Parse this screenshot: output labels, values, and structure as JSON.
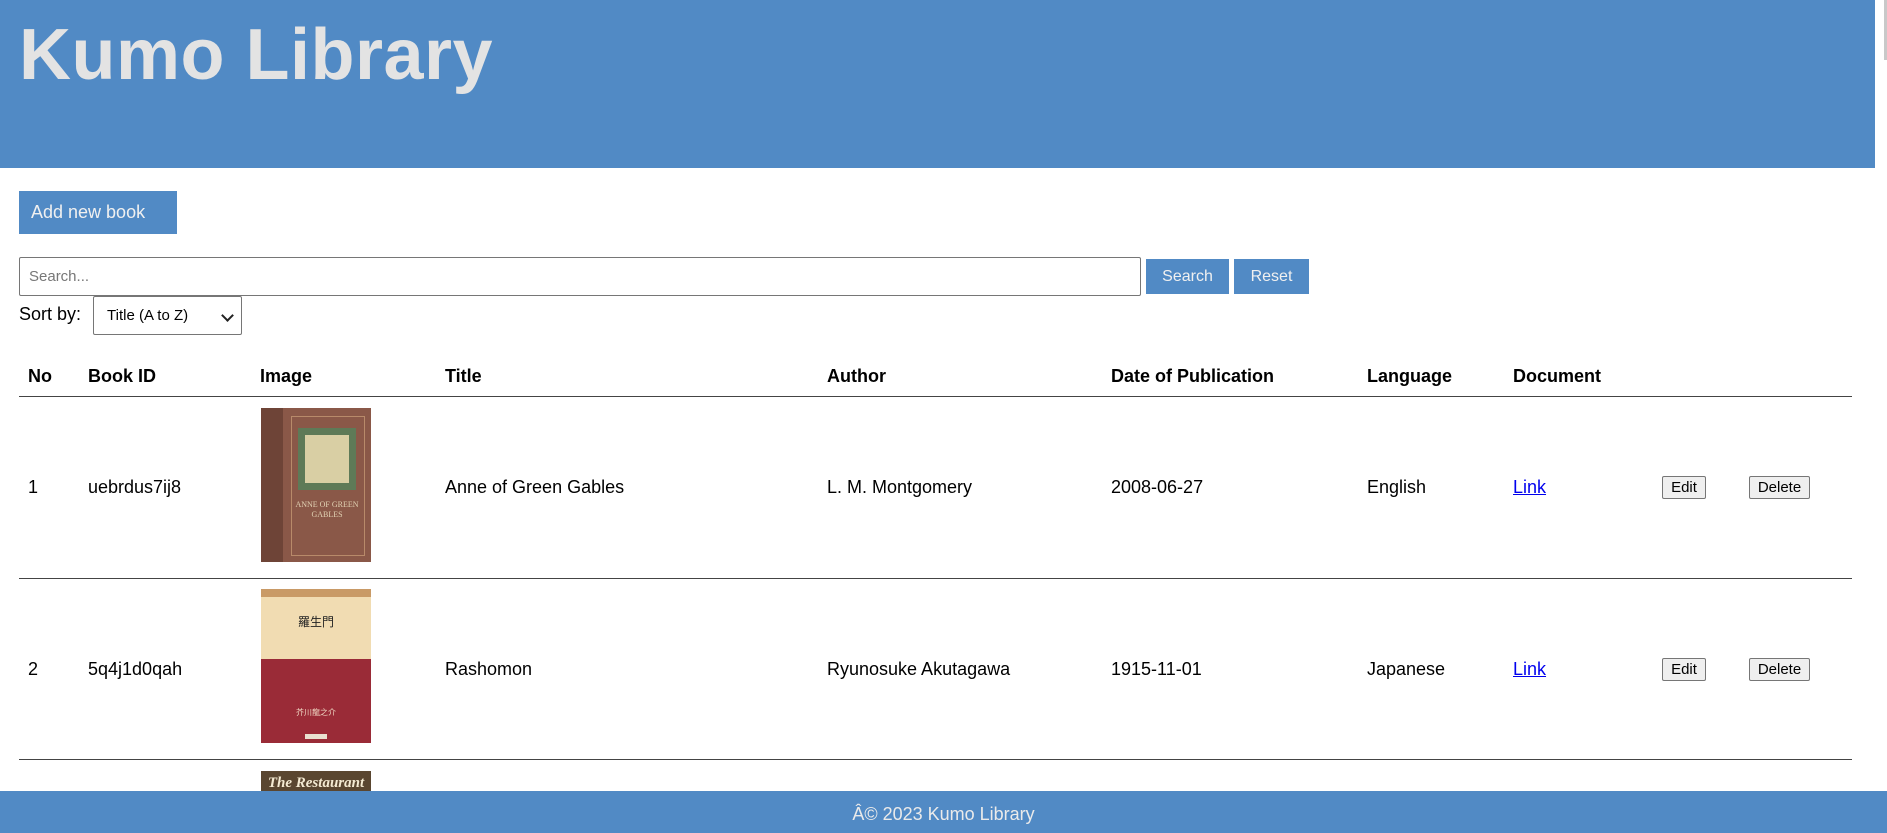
{
  "header": {
    "title": "Kumo Library"
  },
  "actions": {
    "add_label": "Add new book"
  },
  "search": {
    "placeholder": "Search...",
    "button_label": "Search",
    "reset_label": "Reset"
  },
  "sort": {
    "label": "Sort by:",
    "selected": "Title (A to Z)"
  },
  "table": {
    "headers": [
      "No",
      "Book ID",
      "Image",
      "Title",
      "Author",
      "Date of Publication",
      "Language",
      "Document"
    ],
    "rows": [
      {
        "no": "1",
        "book_id": "uebrdus7ij8",
        "title": "Anne of Green Gables",
        "author": "L. M. Montgomery",
        "date": "2008-06-27",
        "language": "English",
        "document": "Link",
        "edit": "Edit",
        "delete": "Delete",
        "cover_text": "ANNE OF GREEN GABLES"
      },
      {
        "no": "2",
        "book_id": "5q4j1d0qah",
        "title": "Rashomon",
        "author": "Ryunosuke Akutagawa",
        "date": "1915-11-01",
        "language": "Japanese",
        "document": "Link",
        "edit": "Edit",
        "delete": "Delete",
        "cover_text": "羅生門",
        "cover_author": "芥川龍之介"
      },
      {
        "cover_text": "The Restaurant"
      }
    ]
  },
  "footer": {
    "text": "Â© 2023 Kumo Library"
  },
  "colors": {
    "brand": "#518ac5",
    "link": "#0000ee"
  }
}
